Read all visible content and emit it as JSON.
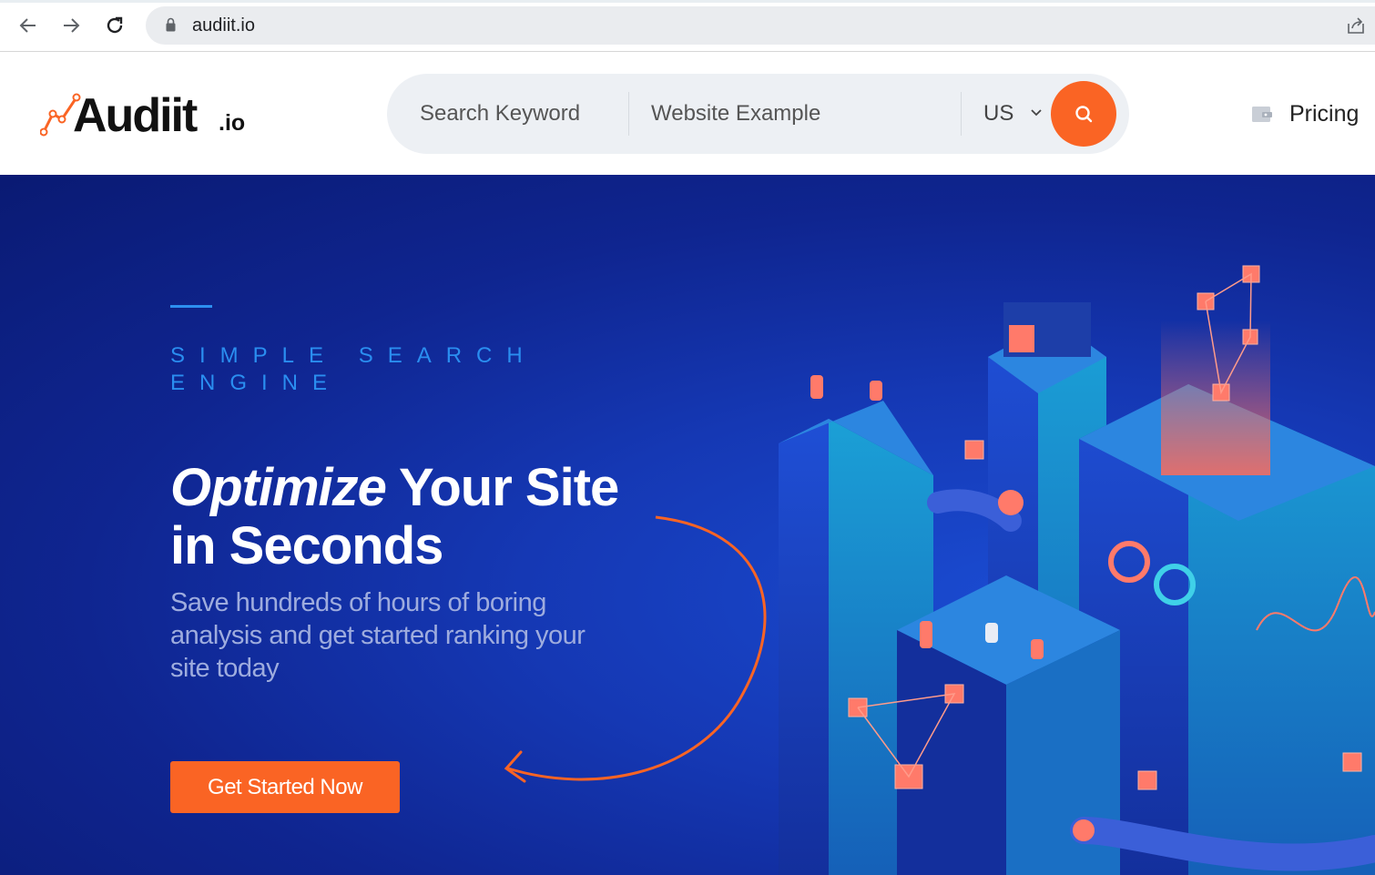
{
  "browser": {
    "url": "audiit.io",
    "icons": [
      "arrow-left-icon",
      "arrow-right-icon",
      "reload-icon",
      "lock-icon",
      "share-icon"
    ]
  },
  "header": {
    "logo_text": "Audiit",
    "logo_tld": ".io",
    "search": {
      "keyword_placeholder": "Search Keyword",
      "website_placeholder": "Website Example",
      "country_value": "US"
    },
    "pricing_label": "Pricing"
  },
  "hero": {
    "eyebrow": "SIMPLE SEARCH ENGINE",
    "title_emphasis": "Optimize",
    "title_rest": " Your Site in Seconds",
    "subtitle": "Save hundreds of hours of boring analysis and get started ranking your site today",
    "cta_label": "Get Started Now"
  },
  "colors": {
    "accent": "#fa6424",
    "hero_bg": "#1538b4",
    "eyebrow": "#2a8ef0",
    "subtitle": "#9eacde"
  }
}
